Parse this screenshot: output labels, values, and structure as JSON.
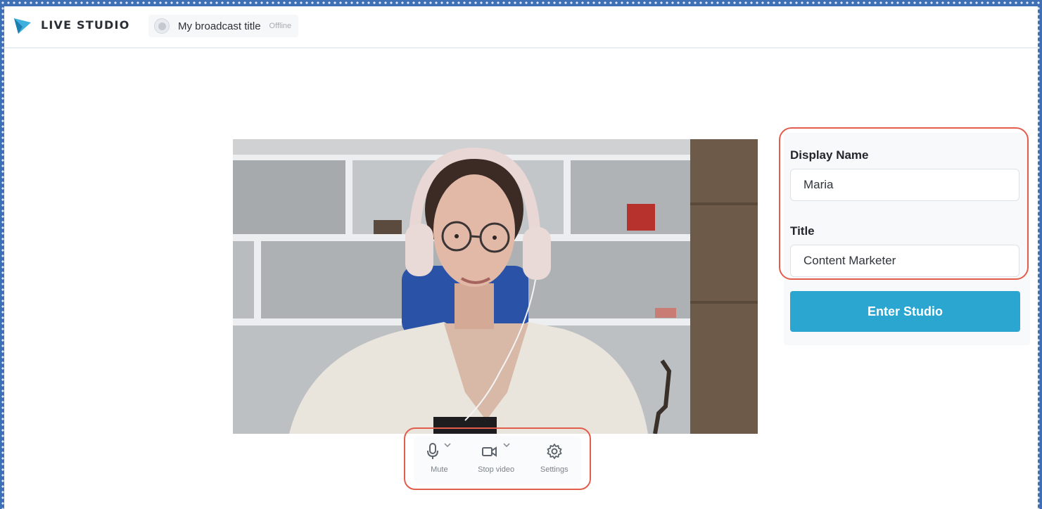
{
  "app": {
    "brand": "LIVE STUDIO",
    "logo_icon": "play-triangle-logo",
    "accent_color": "#2aa6d0",
    "highlight_color": "#e25d4c"
  },
  "broadcast": {
    "title": "My broadcast title",
    "status": "Offline",
    "status_icon": "record-dot-icon"
  },
  "preview": {
    "description_icon": "camera-preview"
  },
  "controls": [
    {
      "label": "Mute",
      "icon": "microphone-icon",
      "has_dropdown": true
    },
    {
      "label": "Stop video",
      "icon": "video-camera-icon",
      "has_dropdown": true
    },
    {
      "label": "Settings",
      "icon": "gear-icon",
      "has_dropdown": false
    }
  ],
  "form": {
    "display_name_label": "Display Name",
    "display_name_value": "Maria",
    "title_label": "Title",
    "title_value": "Content Marketer",
    "enter_button": "Enter Studio"
  }
}
